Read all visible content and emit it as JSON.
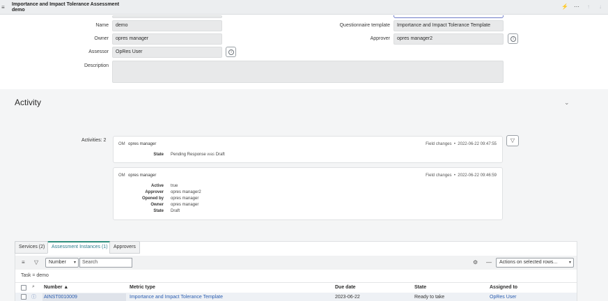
{
  "header": {
    "title_line1": "Importance and Impact Tolerance Assessment",
    "title_line2": "demo",
    "icons": [
      "menu-icon",
      "pulse-icon",
      "more-icon",
      "arrow-up-icon",
      "arrow-down-icon"
    ]
  },
  "form": {
    "name_label": "Name",
    "name_value": "demo",
    "owner_label": "Owner",
    "owner_value": "opres manager",
    "assessor_label": "Assessor",
    "assessor_value": "OpRes User",
    "description_label": "Description",
    "description_value": "",
    "questionnaire_label": "Questionnaire template",
    "questionnaire_value": "Importance and Impact Tolerance Template",
    "approver_label": "Approver",
    "approver_value": "opres manager2"
  },
  "activity": {
    "title": "Activity",
    "count_label": "Activities: 2",
    "entries": [
      {
        "avatar": "OM",
        "user": "opres manager",
        "type": "Field changes",
        "timestamp": "2022-06-22 09:47:55",
        "fields": [
          {
            "key": "State",
            "value": "Pending Response",
            "was": "was",
            "old": "Draft"
          }
        ]
      },
      {
        "avatar": "OM",
        "user": "opres manager",
        "type": "Field changes",
        "timestamp": "2022-06-22 09:46:59",
        "fields": [
          {
            "key": "Active",
            "value": "true"
          },
          {
            "key": "Approver",
            "value": "opres manager2"
          },
          {
            "key": "Opened by",
            "value": "opres manager"
          },
          {
            "key": "Owner",
            "value": "opres manager"
          },
          {
            "key": "State",
            "value": "Draft"
          }
        ]
      }
    ]
  },
  "related": {
    "tabs": [
      {
        "label": "Services (2)"
      },
      {
        "label": "Assessment Instances (1)"
      },
      {
        "label": "Approvers"
      }
    ],
    "filter_field": "Number",
    "search_placeholder": "Search",
    "actions_label": "Actions on selected rows...",
    "breadcrumb": "Task = demo",
    "columns": [
      "Number ▲",
      "Metric type",
      "Due date",
      "State",
      "Assigned to"
    ],
    "rows": [
      {
        "number": "AINST0010009",
        "metric_type": "Importance and Impact Tolerance Template",
        "due_date": "2023-06-22",
        "state": "Ready to take",
        "assigned_to": "OpRes User"
      }
    ]
  },
  "colors": {
    "active_tab": "#2e8f7e",
    "link": "#2a5db0",
    "header_bg": "#eceef0"
  }
}
